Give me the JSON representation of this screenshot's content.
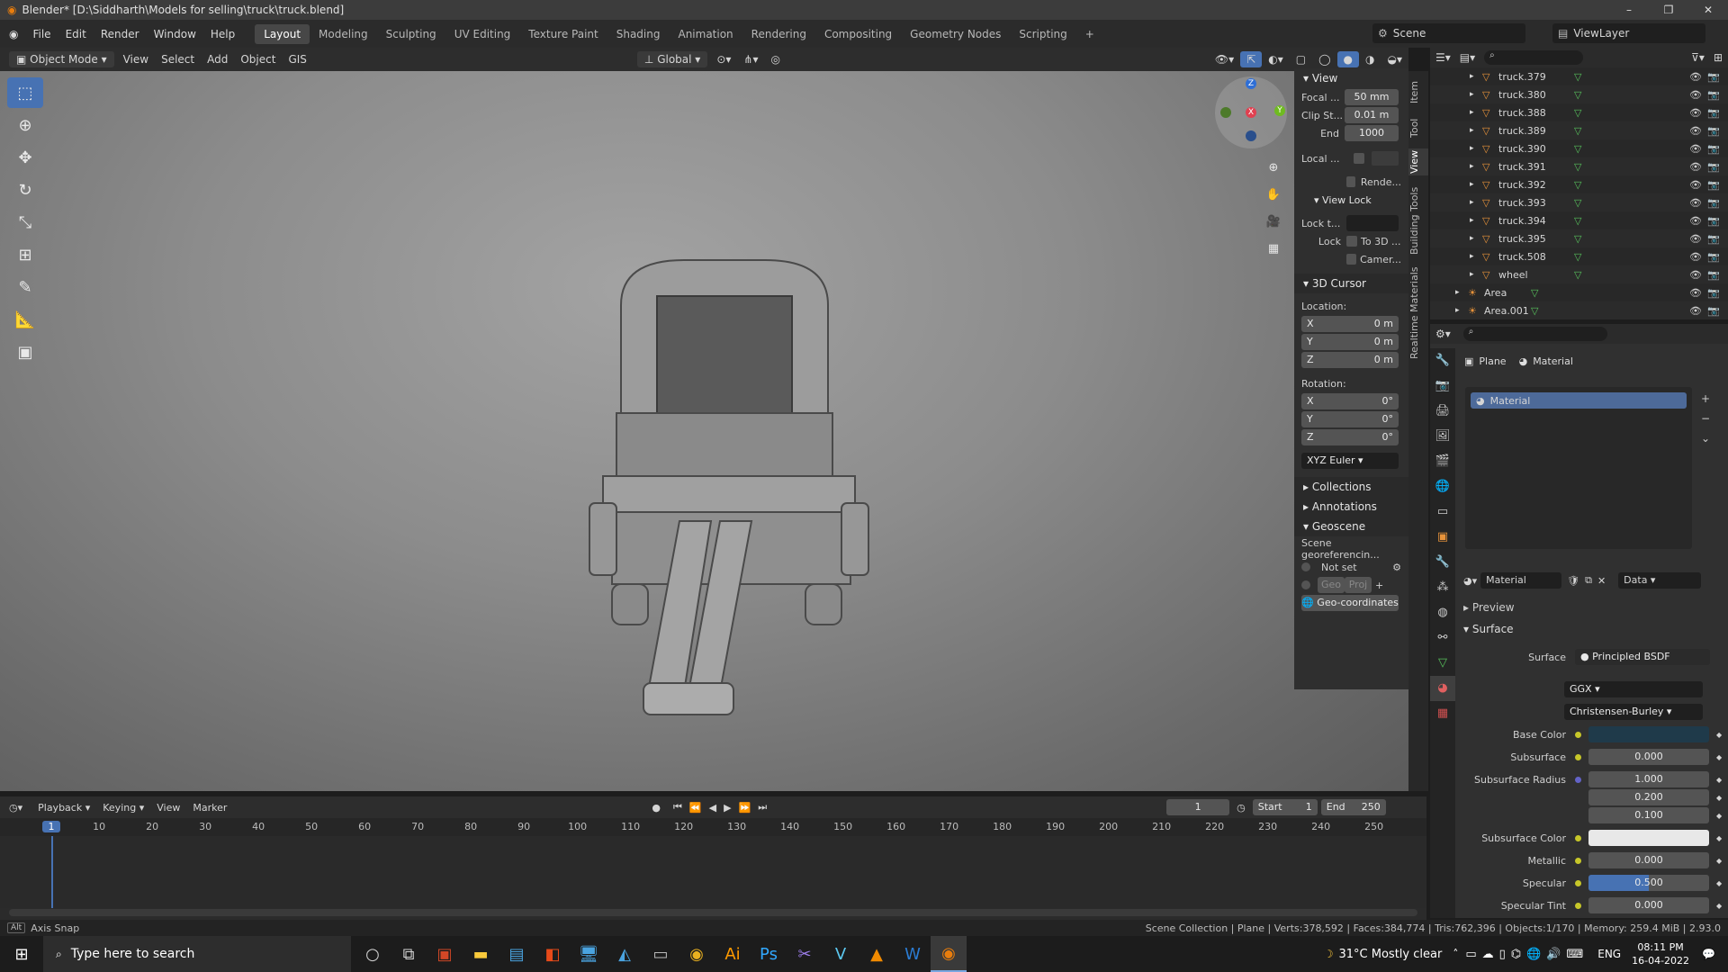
{
  "window": {
    "title": "Blender* [D:\\Siddharth\\Models for selling\\truck\\truck.blend]",
    "minimize": "–",
    "maximize": "❐",
    "close": "✕"
  },
  "menus": [
    "File",
    "Edit",
    "Render",
    "Window",
    "Help"
  ],
  "workspaces": [
    "Layout",
    "Modeling",
    "Sculpting",
    "UV Editing",
    "Texture Paint",
    "Shading",
    "Animation",
    "Rendering",
    "Compositing",
    "Geometry Nodes",
    "Scripting",
    "+"
  ],
  "scene": {
    "name": "Scene",
    "view_layer": "ViewLayer"
  },
  "viewport_header": {
    "mode": "Object Mode",
    "items": [
      "View",
      "Select",
      "Add",
      "Object",
      "GIS"
    ],
    "orientation": "Global"
  },
  "npanel": {
    "view_title": "View",
    "focal_label": "Focal ...",
    "focal_value": "50 mm",
    "clip_start_label": "Clip St...",
    "clip_start_value": "0.01 m",
    "end_label": "End",
    "end_value": "1000",
    "local_label": "Local ...",
    "render_label": "Rende...",
    "view_lock_title": "View Lock",
    "lock_to_label": "Lock t...",
    "lock_label": "Lock",
    "to3d_label": "To 3D ...",
    "camera_label": "Camer...",
    "cursor_title": "3D Cursor",
    "location_label": "Location:",
    "loc_x": "0 m",
    "loc_y": "0 m",
    "loc_z": "0 m",
    "rotation_label": "Rotation:",
    "rot_x": "0°",
    "rot_y": "0°",
    "rot_z": "0°",
    "euler": "XYZ Euler",
    "x": "X",
    "y": "Y",
    "z": "Z",
    "collections": "Collections",
    "annotations": "Annotations",
    "geoscene": "Geoscene",
    "georef": "Scene georeferencin...",
    "not_set": "Not set",
    "geo": "Geo",
    "proj": "Proj",
    "geocoords": "Geo-coordinates"
  },
  "vertical_tabs": [
    "Item",
    "Tool",
    "View",
    "Building Tools",
    "Realtime Materials"
  ],
  "outliner": {
    "rows": [
      {
        "name": "truck.379"
      },
      {
        "name": "truck.380"
      },
      {
        "name": "truck.388"
      },
      {
        "name": "truck.389"
      },
      {
        "name": "truck.390"
      },
      {
        "name": "truck.391"
      },
      {
        "name": "truck.392"
      },
      {
        "name": "truck.393"
      },
      {
        "name": "truck.394"
      },
      {
        "name": "truck.395"
      },
      {
        "name": "truck.508"
      },
      {
        "name": "wheel"
      },
      {
        "name": "Area"
      },
      {
        "name": "Area.001"
      }
    ]
  },
  "properties": {
    "breadcrumb_object": "Plane",
    "breadcrumb_material": "Material",
    "slot": "Material",
    "material_name": "Material",
    "link": "Data",
    "preview": "Preview",
    "surface_section": "Surface",
    "surface_label": "Surface",
    "surface_value": "Principled BSDF",
    "distribution": "GGX",
    "subsurface_method": "Christensen-Burley",
    "fields": [
      {
        "label": "Base Color",
        "value": ""
      },
      {
        "label": "Subsurface",
        "value": "0.000"
      },
      {
        "label": "Subsurface Radius",
        "value": "1.000"
      },
      {
        "label": "",
        "value": "0.200"
      },
      {
        "label": "",
        "value": "0.100"
      },
      {
        "label": "Subsurface Color",
        "value": ""
      },
      {
        "label": "Metallic",
        "value": "0.000"
      },
      {
        "label": "Specular",
        "value": "0.500"
      },
      {
        "label": "Specular Tint",
        "value": "0.000"
      }
    ],
    "base_color": "#1f3a4a",
    "subsurface_color": "#e8e8e8",
    "specular_fill": 0.5
  },
  "timeline": {
    "menus": [
      "Playback",
      "Keying",
      "View",
      "Marker"
    ],
    "current_frame": "1",
    "start_label": "Start",
    "start": "1",
    "end_label": "End",
    "end": "250",
    "ruler": [
      "1",
      "10",
      "20",
      "30",
      "40",
      "50",
      "60",
      "70",
      "80",
      "90",
      "100",
      "110",
      "120",
      "130",
      "140",
      "150",
      "160",
      "170",
      "180",
      "190",
      "200",
      "210",
      "220",
      "230",
      "240",
      "250"
    ]
  },
  "status": {
    "left": "Axis Snap",
    "key": "Alt",
    "right": "Scene Collection | Plane | Verts:378,592 | Faces:384,774 | Tris:762,396 | Objects:1/170 | Memory: 259.4 MiB | 2.93.0"
  },
  "taskbar": {
    "search_placeholder": "Type here to search",
    "weather": "31°C  Mostly clear",
    "lang": "ENG",
    "time": "08:11 PM",
    "date": "16-04-2022"
  },
  "colors": {
    "accent": "#4772b3",
    "selected": "#4d6a99"
  }
}
